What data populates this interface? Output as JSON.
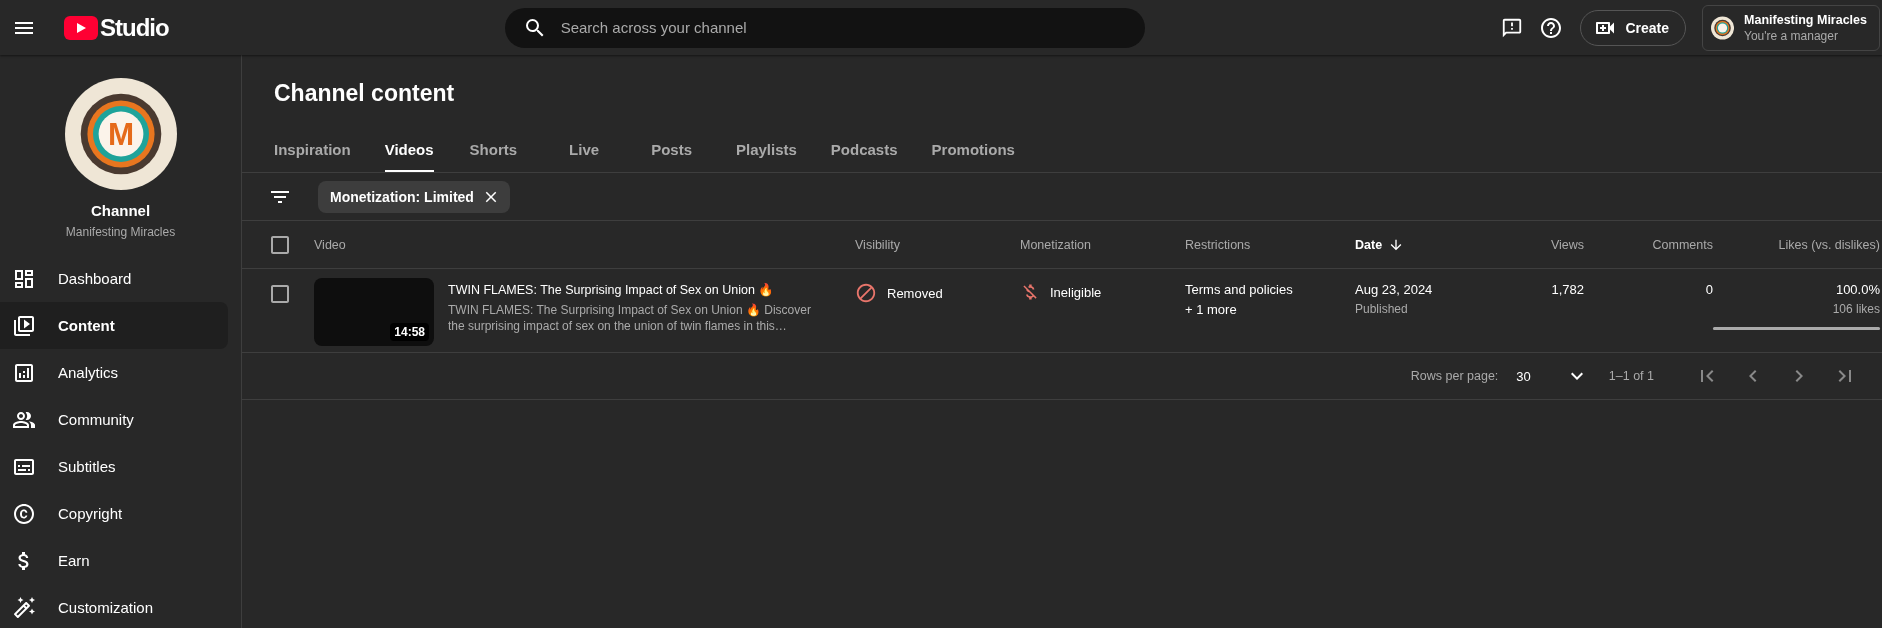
{
  "header": {
    "logo_text": "Studio",
    "search_placeholder": "Search across your channel",
    "create_label": "Create",
    "account": {
      "name": "Manifesting Miracles",
      "role": "You're a manager"
    }
  },
  "sidebar": {
    "channel": {
      "logo_letter": "M",
      "title": "Channel",
      "name": "Manifesting Miracles"
    },
    "items": [
      {
        "label": "Dashboard",
        "kind": "dashboard",
        "selected": false
      },
      {
        "label": "Content",
        "kind": "content",
        "selected": true
      },
      {
        "label": "Analytics",
        "kind": "analytics",
        "selected": false
      },
      {
        "label": "Community",
        "kind": "community",
        "selected": false
      },
      {
        "label": "Subtitles",
        "kind": "subtitles",
        "selected": false
      },
      {
        "label": "Copyright",
        "kind": "copyright",
        "selected": false
      },
      {
        "label": "Earn",
        "kind": "earn",
        "selected": false
      },
      {
        "label": "Customization",
        "kind": "customization",
        "selected": false
      }
    ]
  },
  "page": {
    "title": "Channel content",
    "tabs": [
      {
        "label": "Inspiration",
        "selected": false
      },
      {
        "label": "Videos",
        "selected": true
      },
      {
        "label": "Shorts",
        "selected": false
      },
      {
        "label": "Live",
        "selected": false
      },
      {
        "label": "Posts",
        "selected": false
      },
      {
        "label": "Playlists",
        "selected": false
      },
      {
        "label": "Podcasts",
        "selected": false
      },
      {
        "label": "Promotions",
        "selected": false
      }
    ],
    "filter_chip": "Monetization: Limited"
  },
  "table": {
    "select_all_checked": false,
    "columns": [
      {
        "label": "Video",
        "sorted": false
      },
      {
        "label": "Visibility",
        "sorted": false
      },
      {
        "label": "Monetization",
        "sorted": false
      },
      {
        "label": "Restrictions",
        "sorted": false
      },
      {
        "label": "Date",
        "sorted": true
      },
      {
        "label": "Views",
        "sorted": false
      },
      {
        "label": "Comments",
        "sorted": false
      },
      {
        "label": "Likes (vs. dislikes)",
        "sorted": false
      }
    ],
    "rows": [
      {
        "checked": false,
        "duration": "14:58",
        "title": "TWIN FLAMES: The Surprising Impact of Sex on Union 🔥",
        "description": "TWIN FLAMES: The Surprising Impact of Sex on Union 🔥 Discover the surprising impact of sex on the union of twin flames in this…",
        "visibility": "Removed",
        "monetization": "Ineligible",
        "restrictions": "Terms and policies",
        "restrictions_more": "+ 1 more",
        "date": "Aug 23, 2024",
        "date_status": "Published",
        "views": "1,782",
        "comments": "0",
        "likes_percent": "100.0%",
        "likes_count": "106 likes",
        "level": 1.0
      }
    ]
  },
  "pagination": {
    "rows_per_page_label": "Rows per page:",
    "rows_per_page": "30",
    "range": "1–1 of 1",
    "nav_buttons": [
      {
        "kind": "first",
        "disabled": true
      },
      {
        "kind": "prev",
        "disabled": true
      },
      {
        "kind": "next",
        "disabled": true
      },
      {
        "kind": "last",
        "disabled": true
      }
    ]
  }
}
